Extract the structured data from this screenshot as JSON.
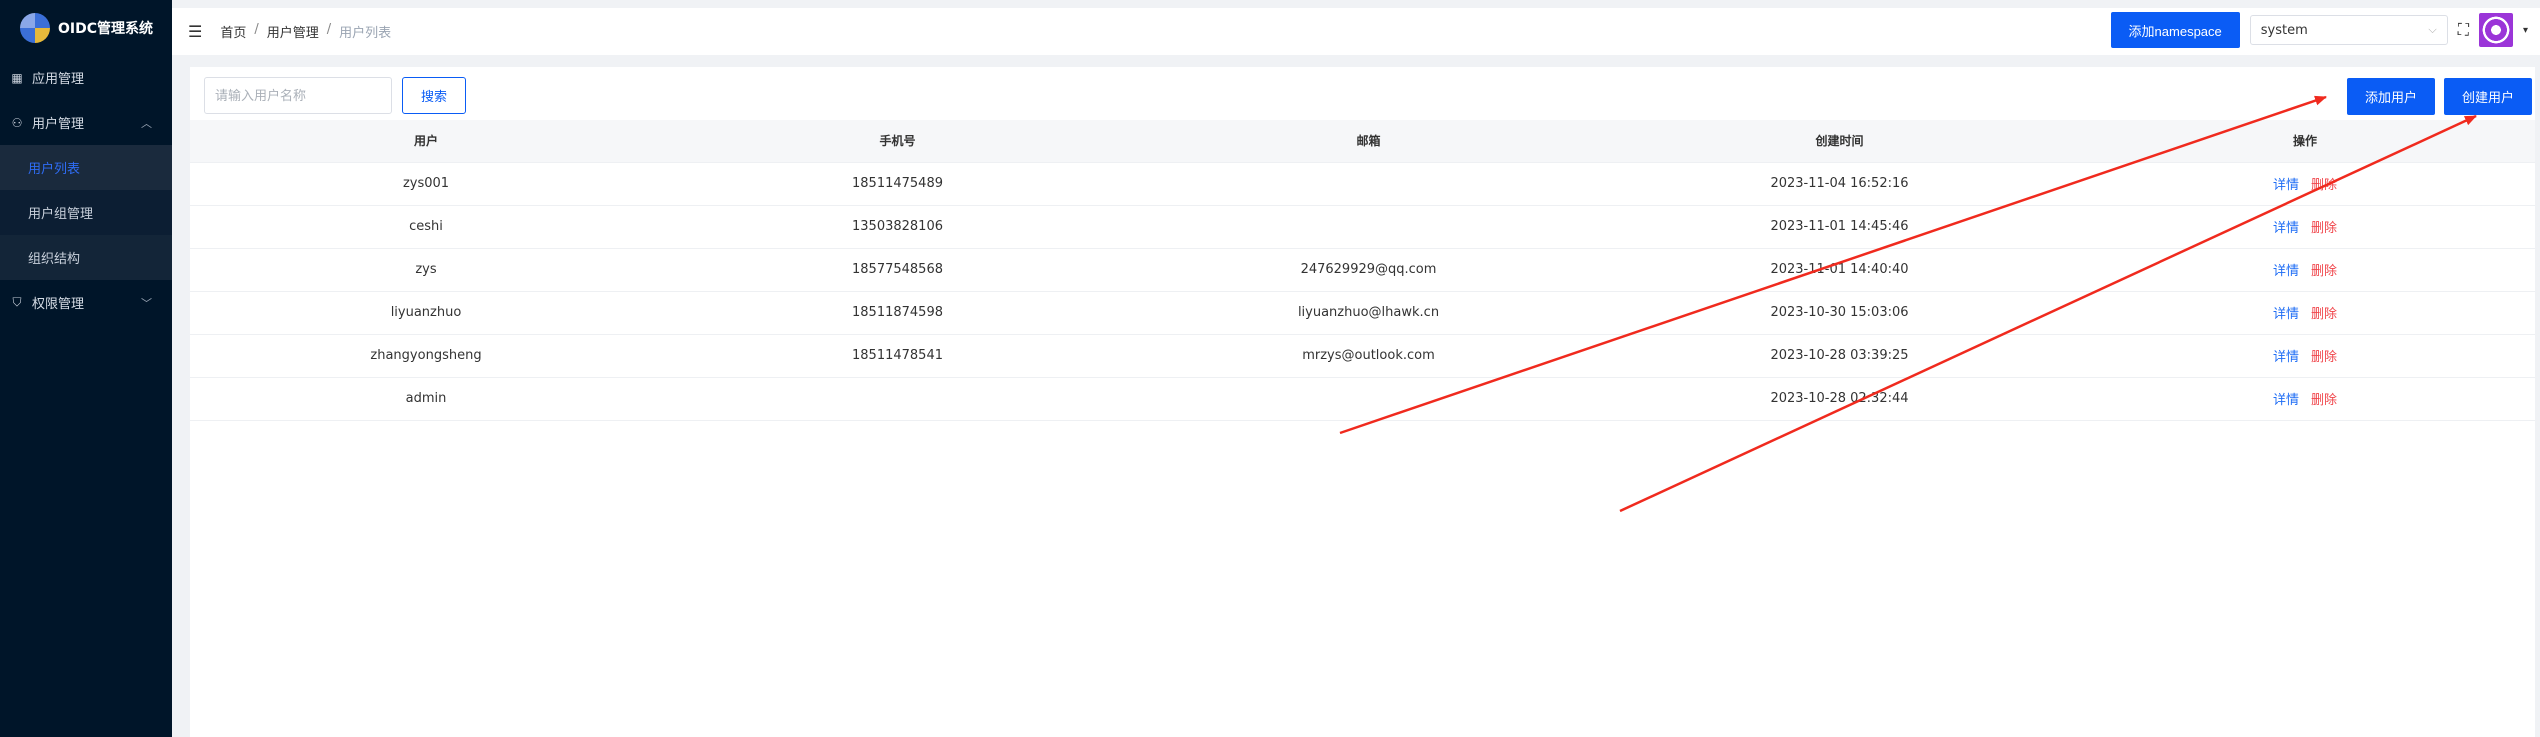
{
  "app": {
    "title": "OIDC管理系统"
  },
  "sidebar": {
    "items": [
      {
        "label": "应用管理",
        "icon": "grid-icon"
      },
      {
        "label": "用户管理",
        "icon": "user-icon",
        "expanded": true,
        "children": [
          {
            "label": "用户列表",
            "active": true
          },
          {
            "label": "用户组管理"
          },
          {
            "label": "组织结构"
          }
        ]
      },
      {
        "label": "权限管理",
        "icon": "shield-icon"
      }
    ]
  },
  "header": {
    "breadcrumb": [
      "首页",
      "用户管理",
      "用户列表"
    ],
    "add_namespace_label": "添加namespace",
    "namespace_value": "system"
  },
  "toolbar": {
    "search_placeholder": "请输入用户名称",
    "search_label": "搜索",
    "add_user_label": "添加用户",
    "create_user_label": "创建用户"
  },
  "table": {
    "columns": [
      "用户",
      "手机号",
      "邮箱",
      "创建时间",
      "操作"
    ],
    "rows": [
      {
        "user": "zys001",
        "phone": "18511475489",
        "email": "",
        "created": "2023-11-04 16:52:16"
      },
      {
        "user": "ceshi",
        "phone": "13503828106",
        "email": "",
        "created": "2023-11-01 14:45:46"
      },
      {
        "user": "zys",
        "phone": "18577548568",
        "email": "247629929@qq.com",
        "created": "2023-11-01 14:40:40"
      },
      {
        "user": "liyuanzhuo",
        "phone": "18511874598",
        "email": "liyuanzhuo@lhawk.cn",
        "created": "2023-10-30 15:03:06"
      },
      {
        "user": "zhangyongsheng",
        "phone": "18511478541",
        "email": "mrzys@outlook.com",
        "created": "2023-10-28 03:39:25"
      },
      {
        "user": "admin",
        "phone": "",
        "email": "",
        "created": "2023-10-28 02:32:44"
      }
    ],
    "action_detail": "详情",
    "action_delete": "删除"
  },
  "colors": {
    "primary": "#0a5cf5",
    "sidebar_bg": "#001529",
    "danger": "#f0444a",
    "annotation": "#f02a1e"
  }
}
